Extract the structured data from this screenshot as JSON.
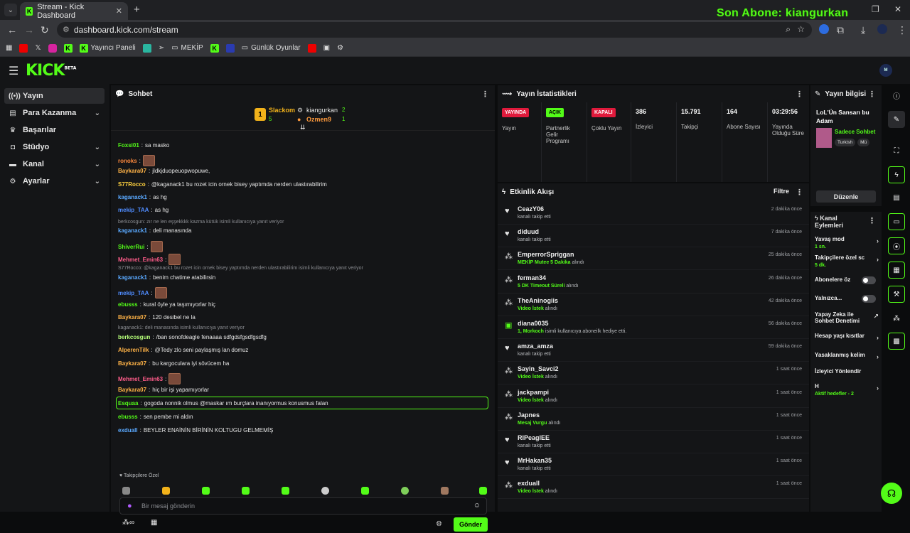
{
  "browser": {
    "tab_title": "Stream - Kick Dashboard",
    "url": "dashboard.kick.com/stream",
    "bookmarks": [
      "Yayıncı Paneli",
      "MEKİP",
      "Günlük Oyunlar"
    ],
    "overlay_text": "Son Abone: kiangurkan"
  },
  "colors": {
    "accent": "#53fc18",
    "live_red": "#e01a3c",
    "bg": "#0b0c0d",
    "panel": "#141517"
  },
  "sidebar": {
    "items": [
      {
        "label": "Yayın",
        "icon": "broadcast-icon",
        "active": true
      },
      {
        "label": "Para Kazanma",
        "icon": "wallet-icon",
        "expandable": true
      },
      {
        "label": "Başarılar",
        "icon": "trophy-icon"
      },
      {
        "label": "Stüdyo",
        "icon": "studio-icon",
        "expandable": true
      },
      {
        "label": "Kanal",
        "icon": "channel-icon",
        "expandable": true
      },
      {
        "label": "Ayarlar",
        "icon": "gear-icon",
        "expandable": true
      }
    ]
  },
  "chat": {
    "title": "Sohbet",
    "pinned": {
      "top_gifter": "Slackom",
      "top_count": "5",
      "gifter2": "kiangurkan",
      "gifter2_count": "2",
      "gifter3": "Ozmen9",
      "gifter3_count": "1"
    },
    "messages": [
      {
        "user": "Foxsi01",
        "text": "sa masko",
        "color": "#53fc18"
      },
      {
        "user": "ronoks",
        "text": "",
        "color": "#ff8a3d",
        "emote": true
      },
      {
        "user": "Baykara07",
        "text": "jldkjduopeuopwopuwe,",
        "color": "#ffb347"
      },
      {
        "user": "S77Rocco",
        "text": "@kaganack1 bu rozet icin ornek bisey yaptımda nerden ulastırabilirim",
        "color": "#ffd23f"
      },
      {
        "user": "kaganack1",
        "text": "as hg",
        "color": "#5aa9ff"
      },
      {
        "user": "mekip_TAA",
        "text": "as hg",
        "color": "#4f8cff"
      },
      {
        "reply": "berkcosgun: zır ne len eşşekkkk kazma kütük isimli kullanıcıya yanıt veriyor"
      },
      {
        "user": "kaganack1",
        "text": "deli manasında",
        "color": "#5aa9ff"
      },
      {
        "user": "ShiverRui",
        "text": "",
        "color": "#53fc18",
        "emote": true
      },
      {
        "user": "Mehmet_Emin63",
        "text": "",
        "color": "#ff5c8a",
        "emote": true
      },
      {
        "reply": "S77Rocco: @kaganack1 bu rozet icin ornek bisey yaptımda nerden ulastırabilirim isimli kullanıcıya yanıt veriyor"
      },
      {
        "user": "kaganack1",
        "text": "benim chatime atabilirsin",
        "color": "#5aa9ff"
      },
      {
        "user": "mekip_TAA",
        "text": "",
        "color": "#4f8cff",
        "emote": true
      },
      {
        "user": "ebusss",
        "text": "kural öyle ya taşımıyorlar hiç",
        "color": "#53fc18"
      },
      {
        "user": "Baykara07",
        "text": "120 desibel ne la",
        "color": "#ffb347"
      },
      {
        "reply": "kaganack1: deli manasında isimli kullanıcıya yanıt veriyor"
      },
      {
        "user": "berkcosgun",
        "text": "/ban sonofdeagle fenaaaa sdfgdsfgsdfgsdfg",
        "color": "#b6ff7a"
      },
      {
        "user": "AlperenTilk",
        "text": "@Tedy zlo seni paylaşmış lan domuz",
        "color": "#ffb347"
      },
      {
        "user": "Baykara07",
        "text": "bu kargoculara iyi sövücem ha",
        "color": "#ffb347"
      },
      {
        "user": "Mehmet_Emin63",
        "text": "",
        "color": "#ff5c8a",
        "emote": true
      },
      {
        "user": "Baykara07",
        "text": "hiç bir işi yapamıyorlar",
        "color": "#ffb347"
      },
      {
        "user": "Esquaa",
        "text": "gogoda nonnik olmus @maskar ım burçlara inanıyormus konusmus falan",
        "color": "#53fc18",
        "highlight": true
      },
      {
        "user": "ebusss",
        "text": "sen pembe mi aldın",
        "color": "#53fc18"
      },
      {
        "user": "exduall",
        "text": "BEYLER ENAİNİN BİRİNİN KOLTUGU GELMEMİŞ",
        "color": "#5aa9ff"
      }
    ],
    "followers_only": "Takipçilere Özel",
    "input_placeholder": "Bir mesaj gönderin",
    "send_label": "Gönder"
  },
  "stats": {
    "title": "Yayın İstatistikleri",
    "items": [
      {
        "pill": "YAYINDA",
        "pill_bg": "#e01a3c",
        "pill_fg": "#ffffff",
        "label": "Yayın"
      },
      {
        "pill": "AÇIK",
        "pill_bg": "#53fc18",
        "pill_fg": "#000000",
        "label": "Partnerlik Gelir Programı"
      },
      {
        "pill": "KAPALI",
        "pill_bg": "#e01a3c",
        "pill_fg": "#ffffff",
        "label": "Çoklu Yayın"
      },
      {
        "value": "386",
        "label": "İzleyici"
      },
      {
        "value": "15.791",
        "label": "Takipçi"
      },
      {
        "value": "164",
        "label": "Abone Sayısı"
      },
      {
        "value": "03:29:56",
        "label": "Yayında Olduğu Süre"
      }
    ]
  },
  "events": {
    "title": "Etkinlik Akışı",
    "filter_label": "Filtre",
    "items": [
      {
        "icon": "heart-icon",
        "name": "CeazY06",
        "desc": "kanalı takip etti",
        "time": "2 dakika önce"
      },
      {
        "icon": "heart-icon",
        "name": "diduud",
        "desc": "kanalı takip etti",
        "time": "7 dakika önce"
      },
      {
        "icon": "dots-icon",
        "name": "EmperrorSpriggan",
        "hl": "MEKİP Mutee 5 Dakika",
        "desc": "alındı",
        "time": "25 dakika önce"
      },
      {
        "icon": "dots-icon",
        "name": "ferman34",
        "hl": "5 DK Timeout Süreli",
        "desc": "alındı",
        "time": "26 dakika önce"
      },
      {
        "icon": "dots-icon",
        "name": "TheAninogiis",
        "hl": "Video İstek",
        "desc": "alındı",
        "time": "42 dakika önce"
      },
      {
        "icon": "gift-icon",
        "name": "diana0035",
        "hl": "1, Morkoch",
        "desc": "isimli kullanıcıya aboneilk hediye etti.",
        "time": "56 dakika önce"
      },
      {
        "icon": "heart-icon",
        "name": "amza_amza",
        "desc": "kanalı takip etti",
        "time": "59 dakika önce"
      },
      {
        "icon": "dots-icon",
        "name": "Sayin_Savci2",
        "hl": "Video İstek",
        "desc": "alındı",
        "time": "1 saat önce"
      },
      {
        "icon": "dots-icon",
        "name": "jackpampi",
        "hl": "Video İstek",
        "desc": "alındı",
        "time": "1 saat önce"
      },
      {
        "icon": "dots-icon",
        "name": "Japnes",
        "hl": "Mesaj Vurgu",
        "desc": "alındı",
        "time": "1 saat önce"
      },
      {
        "icon": "heart-icon",
        "name": "RIPeaglEE",
        "desc": "kanalı takip etti",
        "time": "1 saat önce"
      },
      {
        "icon": "heart-icon",
        "name": "MrHakan35",
        "desc": "kanalı takip etti",
        "time": "1 saat önce"
      },
      {
        "icon": "dots-icon",
        "name": "exduall",
        "hl": "Video İstek",
        "desc": "alındı",
        "time": "1 saat önce"
      }
    ]
  },
  "stream_info": {
    "title": "Yayın bilgisi",
    "stream_title": "LoL'Ün Sansarı bu Adam",
    "category": "Sadece Sohbet",
    "tags": [
      "Turkish",
      "Mü"
    ],
    "edit_label": "Düzenle"
  },
  "channel_actions": {
    "title": "Kanal Eylemleri",
    "items": [
      {
        "label": "Yavaş mod",
        "sub": "1 sn.",
        "kind": "arrow"
      },
      {
        "label": "Takipçilere özel sc",
        "sub": "5 dk.",
        "kind": "arrow"
      },
      {
        "label": "Abonelere öz",
        "kind": "toggle"
      },
      {
        "label": "Yalnızca...",
        "kind": "toggle"
      },
      {
        "label": "Yapay Zeka ile Sohbet Denetimi",
        "kind": "external"
      },
      {
        "label": "Hesap yaşı kısıtlar",
        "kind": "arrow"
      },
      {
        "label": "Yasaklanmış kelim",
        "kind": "arrow"
      },
      {
        "label": "İzleyici Yönlendir",
        "kind": "none"
      },
      {
        "label": "H",
        "sub": "Aktif hedefler - 2",
        "kind": "arrow"
      }
    ]
  }
}
